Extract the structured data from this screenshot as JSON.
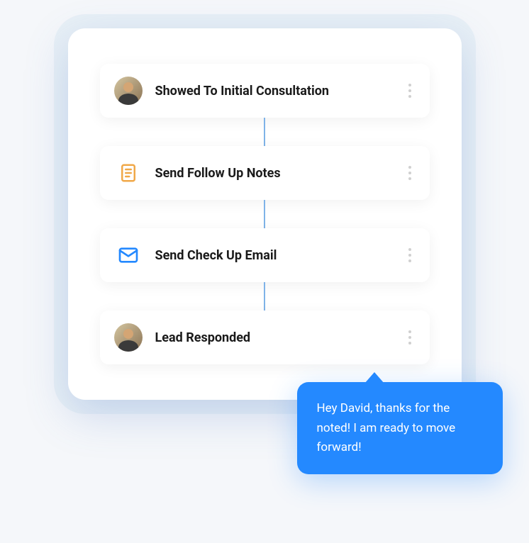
{
  "timeline": {
    "items": [
      {
        "icon": "avatar",
        "title": "Showed To Initial Consultation"
      },
      {
        "icon": "notes",
        "title": "Send Follow Up Notes"
      },
      {
        "icon": "email",
        "title": "Send Check Up Email"
      },
      {
        "icon": "avatar",
        "title": "Lead Responded"
      }
    ]
  },
  "response": {
    "message": "Hey David, thanks for the noted! I am ready to move forward!"
  },
  "colors": {
    "accent": "#2489ff",
    "notes_icon": "#f0a848",
    "email_icon": "#2489ff"
  }
}
